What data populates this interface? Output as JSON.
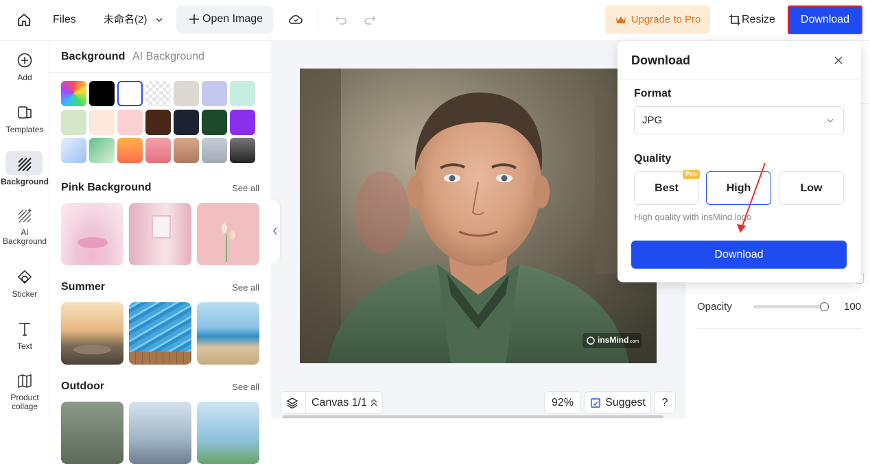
{
  "topbar": {
    "files_label": "Files",
    "doc_name": "未命名(2)",
    "open_image_label": "Open Image",
    "upgrade_label": "Upgrade to Pro",
    "resize_label": "Resize",
    "download_label": "Download"
  },
  "rail": {
    "items": [
      {
        "label": "Add",
        "icon": "plus-circle-icon"
      },
      {
        "label": "Templates",
        "icon": "templates-icon"
      },
      {
        "label": "Background",
        "icon": "background-icon"
      },
      {
        "label": "AI Background",
        "icon": "ai-background-icon"
      },
      {
        "label": "Sticker",
        "icon": "sticker-icon"
      },
      {
        "label": "Text",
        "icon": "text-icon"
      },
      {
        "label": "Product collage",
        "icon": "collage-icon"
      }
    ]
  },
  "panel": {
    "tab_background": "Background",
    "tab_ai_background": "AI Background",
    "sections": [
      {
        "title": "Pink Background",
        "see_all": "See all"
      },
      {
        "title": "Summer",
        "see_all": "See all"
      },
      {
        "title": "Outdoor",
        "see_all": "See all"
      }
    ]
  },
  "canvas": {
    "watermark": "insMind",
    "watermark_suffix": ".com",
    "canvas_label": "Canvas 1/1",
    "zoom": "92%",
    "suggest_label": "Suggest",
    "help_label": "?"
  },
  "right_panel": {
    "opacity_label": "Opacity",
    "opacity_value": "100"
  },
  "download_popup": {
    "title": "Download",
    "format_label": "Format",
    "format_value": "JPG",
    "quality_label": "Quality",
    "quality_options": [
      "Best",
      "High",
      "Low"
    ],
    "pro_badge": "Pro",
    "quality_note": "High quality with insMind logo",
    "download_button": "Download"
  },
  "colors": {
    "accent": "#1f4cf0",
    "upgrade_bg": "#fdebd6",
    "upgrade_text": "#e2741d"
  }
}
